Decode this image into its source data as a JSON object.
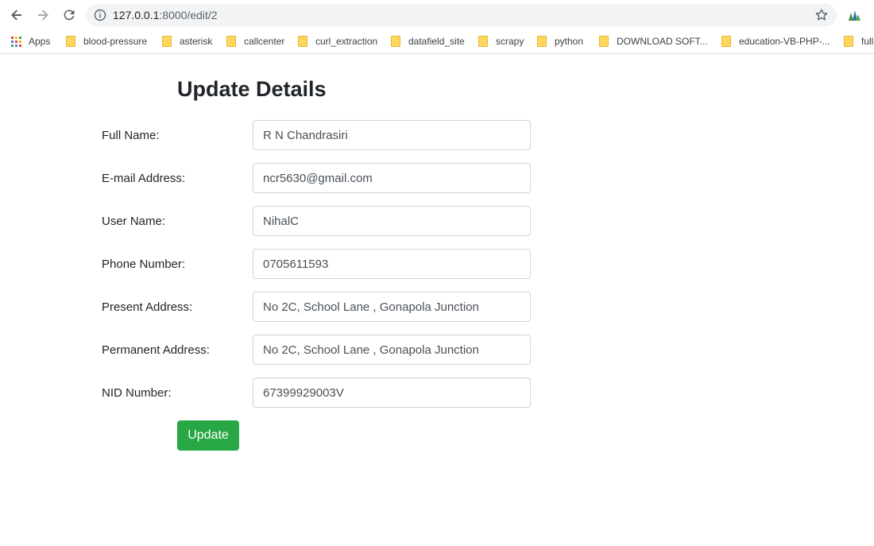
{
  "browser": {
    "url_host": "127.0.0.1",
    "url_rest": ":8000/edit/2",
    "icons": {
      "back": "back-arrow-icon",
      "forward": "forward-arrow-icon",
      "reload": "reload-icon",
      "info": "info-icon",
      "star": "star-icon",
      "extension": "extension-icon"
    }
  },
  "bookmarks": {
    "apps_label": "Apps",
    "items": [
      {
        "label": "blood-pressure"
      },
      {
        "label": "asterisk"
      },
      {
        "label": "callcenter"
      },
      {
        "label": "curl_extraction"
      },
      {
        "label": "datafield_site"
      },
      {
        "label": "scrapy"
      },
      {
        "label": "python"
      },
      {
        "label": "DOWNLOAD SOFT..."
      },
      {
        "label": "education-VB-PHP-..."
      },
      {
        "label": "full"
      }
    ]
  },
  "form": {
    "title": "Update Details",
    "fields": [
      {
        "label": "Full Name:",
        "value": "R N Chandrasiri"
      },
      {
        "label": "E-mail Address:",
        "value": "ncr5630@gmail.com"
      },
      {
        "label": "User Name:",
        "value": "NihalC"
      },
      {
        "label": "Phone Number:",
        "value": "0705611593"
      },
      {
        "label": "Present Address:",
        "value": "No 2C, School Lane , Gonapola Junction"
      },
      {
        "label": "Permanent Address:",
        "value": "No 2C, School Lane , Gonapola Junction"
      },
      {
        "label": "NID Number:",
        "value": "67399929003V"
      }
    ],
    "submit_label": "Update"
  },
  "colors": {
    "submit": "#28a745",
    "folder": "#ffd75e"
  }
}
